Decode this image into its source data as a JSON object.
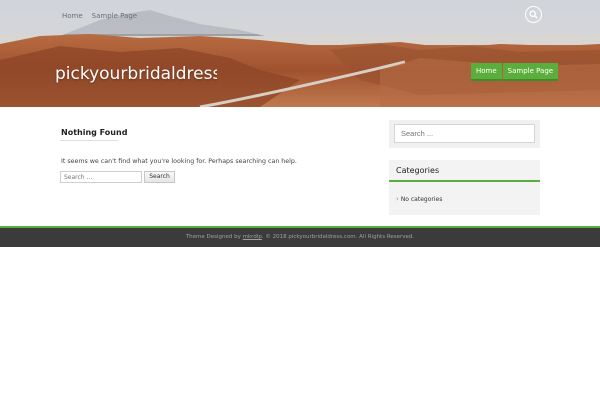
{
  "topnav": {
    "items": [
      "Home",
      "Sample Page"
    ]
  },
  "header": {
    "site_title": "pickyourbridaldress.com",
    "menu": [
      "Home",
      "Sample Page"
    ]
  },
  "main": {
    "title": "Nothing Found",
    "notice": "It seems we can't find what you're looking for. Perhaps searching can help.",
    "search_placeholder": "Search ...",
    "search_button": "Search"
  },
  "sidebar": {
    "search_placeholder": "Search ...",
    "categories_title": "Categories",
    "categories_empty": "No categories"
  },
  "footer": {
    "prefix": "Theme Designed by ",
    "link": "mkrdip",
    "suffix": ". © 2018 pickyourbridaldress.com. All Rights Reserved."
  },
  "colors": {
    "accent": "#5cae3c",
    "footer_bg": "#3b3b3b"
  },
  "icons": {
    "top_search": "search-icon",
    "category_bullet": "chevron-right-icon"
  }
}
